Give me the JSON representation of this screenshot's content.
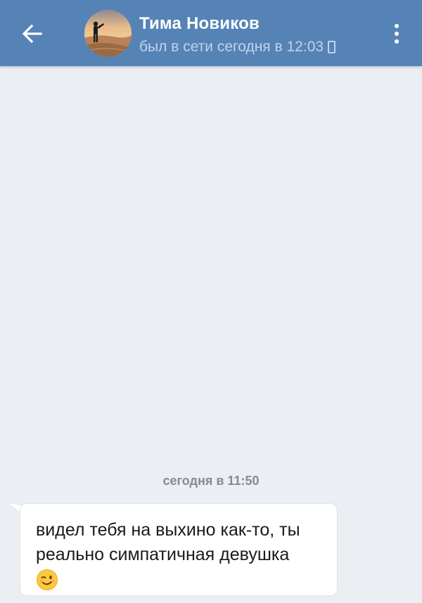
{
  "header": {
    "back_icon": "arrow-left-icon",
    "contact_name": "Тима Новиков",
    "status": "был в сети сегодня в 12:03",
    "status_device_icon": "mobile-icon",
    "menu_icon": "more-vertical-icon",
    "background_color": "#5683b6"
  },
  "chat": {
    "background_color": "#ebeef2",
    "date_separator": "сегодня в 11:50",
    "messages": [
      {
        "direction": "incoming",
        "text": "видел тебя на выхино как-то, ты реально симпатичная девушка",
        "emoji": "😉"
      }
    ]
  }
}
